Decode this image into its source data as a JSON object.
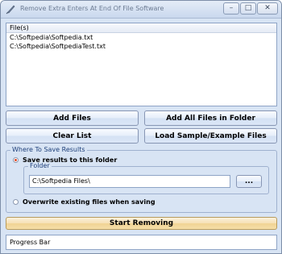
{
  "window": {
    "title": "Remove Extra Enters At End Of File Software",
    "icon": "feather-pen-icon",
    "controls": {
      "minimize": "–",
      "maximize": "□",
      "close": "✕"
    }
  },
  "file_list": {
    "header": "File(s)",
    "items": [
      "C:\\Softpedia\\Softpedia.txt",
      "C:\\Softpedia\\SoftpediaTest.txt"
    ]
  },
  "buttons": {
    "add_files": "Add Files",
    "add_all_files": "Add All Files in Folder",
    "clear_list": "Clear List",
    "load_sample": "Load Sample/Example Files",
    "start": "Start Removing"
  },
  "save_options": {
    "legend": "Where To Save Results",
    "option_folder": "Save results to this folder",
    "option_folder_selected": true,
    "folder_legend": "Folder",
    "folder_value": "C:\\Softpedia Files\\",
    "browse": "...",
    "option_overwrite": "Overwrite existing files when saving",
    "option_overwrite_selected": false
  },
  "status": {
    "progress_label": "Progress Bar"
  },
  "colors": {
    "window_bg": "#d8e4f4",
    "accent_text": "#1e3f7a",
    "start_button": "#f1d394",
    "radio_selected": "#e04a2a"
  }
}
